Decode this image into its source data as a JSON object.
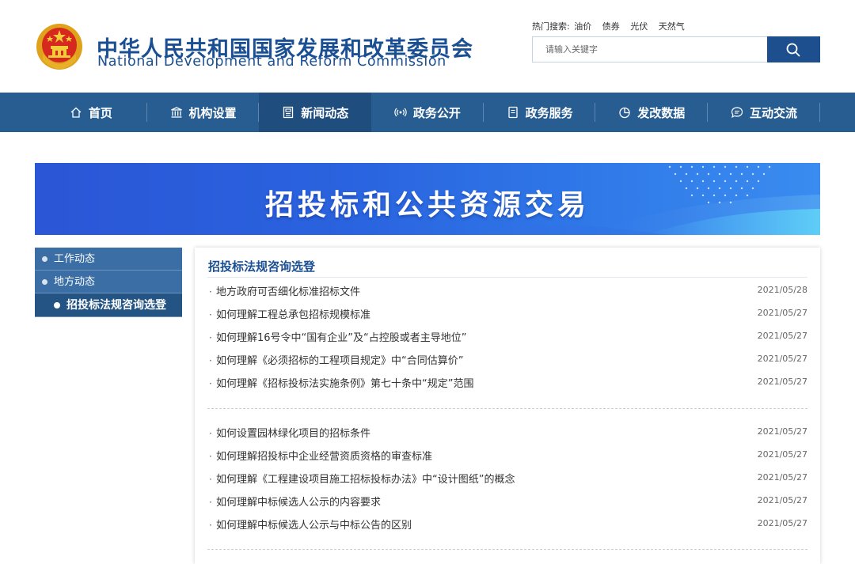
{
  "header": {
    "title": "中华人民共和国国家发展和改革委员会",
    "subtitle": "National Development and Reform Commission",
    "hot_search_label": "热门搜索:",
    "hot_search_items": [
      "油价",
      "债券",
      "光伏",
      "天然气"
    ],
    "search_placeholder": "请输入关键字"
  },
  "nav": {
    "items": [
      {
        "label": "首页",
        "icon": "home-icon"
      },
      {
        "label": "机构设置",
        "icon": "institution-icon"
      },
      {
        "label": "新闻动态",
        "icon": "news-icon",
        "active": true
      },
      {
        "label": "政务公开",
        "icon": "broadcast-icon"
      },
      {
        "label": "政务服务",
        "icon": "document-icon"
      },
      {
        "label": "发改数据",
        "icon": "pie-chart-icon"
      },
      {
        "label": "互动交流",
        "icon": "chat-icon"
      }
    ]
  },
  "banner": {
    "title": "招投标和公共资源交易"
  },
  "sidebar": {
    "items": [
      {
        "label": "工作动态"
      },
      {
        "label": "地方动态"
      },
      {
        "label": "招投标法规咨询选登",
        "active": true
      }
    ]
  },
  "content": {
    "title": "招投标法规咨询选登",
    "groups": [
      [
        {
          "title": "地方政府可否细化标准招标文件",
          "date": "2021/05/28"
        },
        {
          "title": "如何理解工程总承包招标规模标准",
          "date": "2021/05/27"
        },
        {
          "title": "如何理解16号令中“国有企业”及“占控股或者主导地位”",
          "date": "2021/05/27"
        },
        {
          "title": "如何理解《必须招标的工程项目规定》中“合同估算价”",
          "date": "2021/05/27"
        },
        {
          "title": "如何理解《招标投标法实施条例》第七十条中“规定”范围",
          "date": "2021/05/27"
        }
      ],
      [
        {
          "title": "如何设置园林绿化项目的招标条件",
          "date": "2021/05/27"
        },
        {
          "title": "如何理解招投标中企业经营资质资格的审查标准",
          "date": "2021/05/27"
        },
        {
          "title": "如何理解《工程建设项目施工招标投标办法》中“设计图纸”的概念",
          "date": "2021/05/27"
        },
        {
          "title": "如何理解中标候选人公示的内容要求",
          "date": "2021/05/27"
        },
        {
          "title": "如何理解中标候选人公示与中标公告的区别",
          "date": "2021/05/27"
        }
      ]
    ]
  },
  "colors": {
    "brand_blue": "#1b4f93",
    "nav_bg": "#285d92",
    "nav_active": "#1f4d7e",
    "sidebar_bg": "#3a6ea5",
    "sidebar_active": "#245483",
    "banner_blue": "#2a63df"
  }
}
